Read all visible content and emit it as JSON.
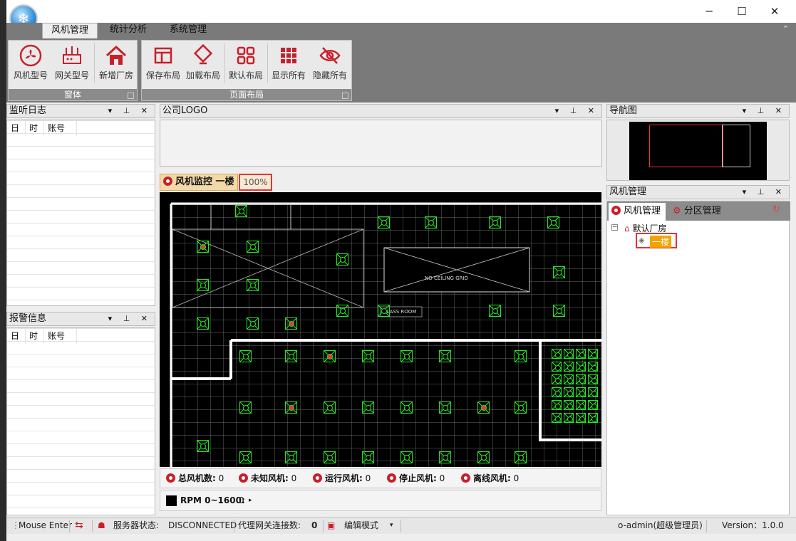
{
  "ribbon": {
    "tabs": [
      "风机管理",
      "统计分析",
      "系统管理"
    ],
    "groups": [
      {
        "title": "窗体",
        "buttons": [
          "风机型号",
          "网关型号",
          "新增厂房"
        ]
      },
      {
        "title": "页面布局",
        "buttons": [
          "保存布局",
          "加载布局",
          "默认布局",
          "显示所有",
          "隐藏所有"
        ]
      }
    ]
  },
  "monitor_log": {
    "title": "监听日志",
    "columns": [
      "日",
      "时",
      "账号"
    ]
  },
  "alarm_info": {
    "title": "报警信息",
    "columns": [
      "日",
      "时",
      "账号"
    ]
  },
  "logo_panel": {
    "title": "公司LOGO"
  },
  "doc_tab": {
    "label": "风机监控 一楼",
    "zoom": "100%"
  },
  "cad_text": {
    "t1": "NO CEILING GRID",
    "t2": "GLASS ROOM"
  },
  "stats": [
    {
      "label": "总风机数:",
      "value": "0"
    },
    {
      "label": "未知风机:",
      "value": "0"
    },
    {
      "label": "运行风机:",
      "value": "0"
    },
    {
      "label": "停止风机:",
      "value": "0"
    },
    {
      "label": "离线风机:",
      "value": "0"
    }
  ],
  "rpm": {
    "label": "RPM 0~1600:",
    "value": "0"
  },
  "nav_panel": {
    "title": "导航图"
  },
  "fan_panel": {
    "title": "风机管理",
    "tabs": [
      "风机管理",
      "分区管理"
    ],
    "tree_root": "默认厂房",
    "tree_child": "一楼"
  },
  "statusbar": {
    "mouse": "Mouse Enter",
    "server_label": "服务器状态:",
    "server_value": "DISCONNECTED",
    "proxy_label": "代理网关连接数:",
    "proxy_value": "0",
    "edit_mode": "编辑模式",
    "user": "o-admin(超级管理员)",
    "version": "Version：1.0.0"
  }
}
